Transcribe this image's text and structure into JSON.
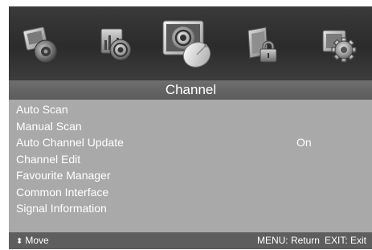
{
  "menu": {
    "title": "Channel",
    "icons": [
      {
        "name": "picture-icon",
        "selected": false
      },
      {
        "name": "sound-icon",
        "selected": false
      },
      {
        "name": "channel-icon",
        "selected": true
      },
      {
        "name": "lock-icon",
        "selected": false
      },
      {
        "name": "setup-icon",
        "selected": false
      }
    ],
    "items": [
      {
        "label": "Auto Scan",
        "value": ""
      },
      {
        "label": "Manual Scan",
        "value": ""
      },
      {
        "label": "Auto Channel Update",
        "value": "On"
      },
      {
        "label": "Channel Edit",
        "value": ""
      },
      {
        "label": "Favourite Manager",
        "value": ""
      },
      {
        "label": "Common Interface",
        "value": ""
      },
      {
        "label": "Signal Information",
        "value": ""
      }
    ]
  },
  "footer": {
    "move_icon": "up-down-arrow-icon",
    "move_label": "Move",
    "menu_hint": "MENU: Return",
    "exit_hint": "EXIT: Exit"
  },
  "colors": {
    "panel_bg": "#a9a9a9",
    "icon_bar_bg": "#2f2f2f",
    "title_bar_bg": "#666666",
    "footer_bg": "#5e5e5e",
    "text": "#ffffff"
  }
}
